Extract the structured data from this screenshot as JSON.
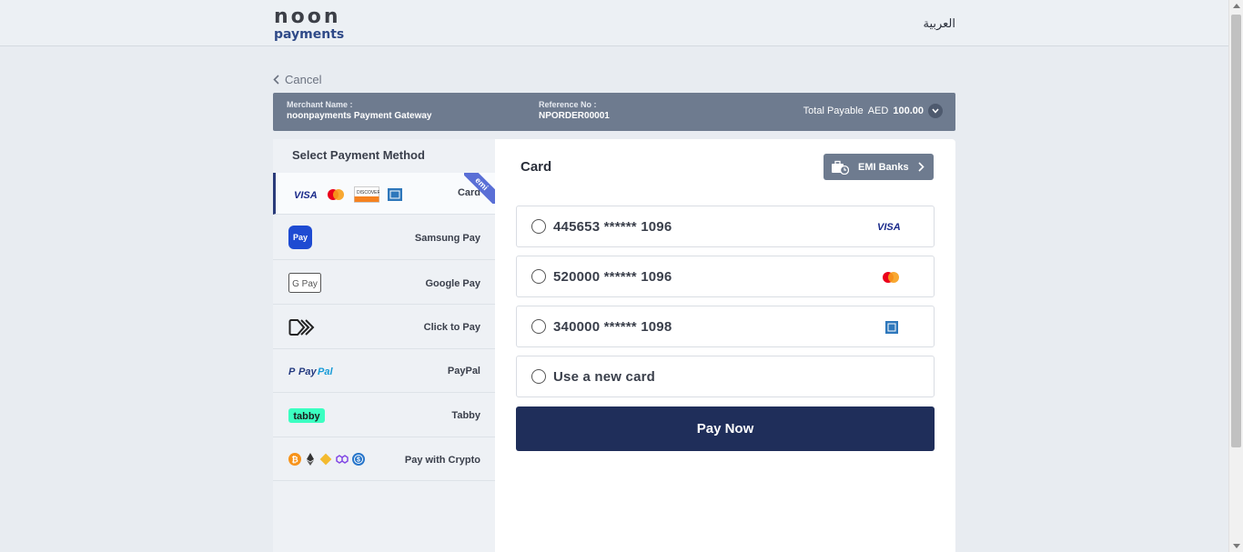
{
  "header": {
    "logo_line1": "noon",
    "logo_line2": "payments",
    "language_link": "العربية"
  },
  "cancel_label": "Cancel",
  "summary": {
    "merchant_label": "Merchant Name :",
    "merchant_value": "noonpayments Payment Gateway",
    "reference_label": "Reference No :",
    "reference_value": "NPORDER00001",
    "total_label": "Total Payable",
    "currency": "AED",
    "amount": "100.00"
  },
  "sidebar": {
    "title": "Select Payment Method",
    "methods": [
      {
        "name": "Card",
        "badge": "emi",
        "icons": [
          "visa-icon",
          "mastercard-icon",
          "discover-icon",
          "amex-icon"
        ],
        "active": true
      },
      {
        "name": "Samsung Pay",
        "icon": "samsung-pay-icon",
        "icon_text": "Pay"
      },
      {
        "name": "Google Pay",
        "icon": "google-pay-icon",
        "icon_text": "G Pay"
      },
      {
        "name": "Click to Pay",
        "icon": "click-to-pay-icon"
      },
      {
        "name": "PayPal",
        "icon": "paypal-icon",
        "icon_text": "PayPal"
      },
      {
        "name": "Tabby",
        "icon": "tabby-icon",
        "icon_text": "tabby"
      },
      {
        "name": "Pay with Crypto",
        "icons": [
          "bitcoin-icon",
          "ethereum-icon",
          "binance-icon",
          "polygon-icon",
          "usdc-icon"
        ]
      }
    ]
  },
  "main": {
    "title": "Card",
    "emi_button": "EMI Banks",
    "saved_cards": [
      {
        "number": "445653 ****** 1096",
        "brand": "visa-icon",
        "brand_text": "VISA"
      },
      {
        "number": "520000 ****** 1096",
        "brand": "mastercard-icon"
      },
      {
        "number": "340000 ****** 1098",
        "brand": "amex-icon"
      }
    ],
    "new_card_label": "Use a new card",
    "pay_button": "Pay Now"
  },
  "colors": {
    "summary_bar": "#6e7b8f",
    "pay_button": "#1f2e5a",
    "active_accent": "#2a3b7a",
    "emi_ribbon": "#5a6fd6"
  }
}
